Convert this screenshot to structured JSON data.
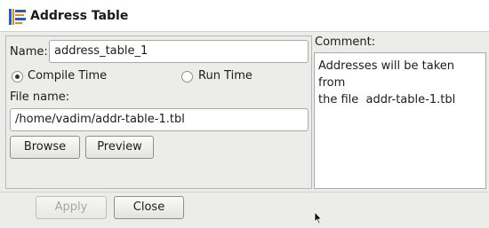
{
  "window": {
    "title": "Address Table",
    "icon": "address-table-icon"
  },
  "form": {
    "name_label": "Name:",
    "name_value": "address_table_1",
    "radio_compile": "Compile Time",
    "radio_run": "Run Time",
    "selected_radio": "compile",
    "file_label": "File name:",
    "file_value": "/home/vadim/addr-table-1.tbl",
    "browse_label": "Browse",
    "preview_label": "Preview"
  },
  "comment": {
    "label": "Comment:",
    "text": "Addresses will be taken from\nthe file  addr-table-1.tbl"
  },
  "footer": {
    "apply_label": "Apply",
    "close_label": "Close"
  }
}
